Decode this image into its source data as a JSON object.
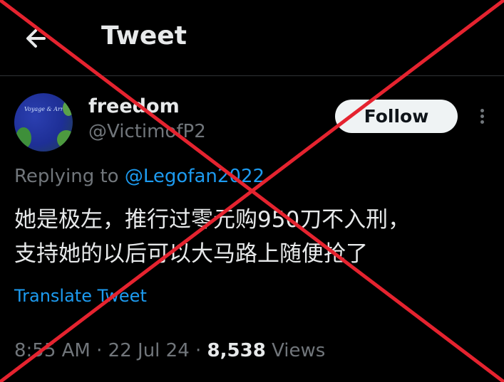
{
  "header": {
    "title": "Tweet",
    "back_icon": "arrow-left-icon"
  },
  "author": {
    "display_name": "freedom",
    "handle": "@VictimofP2",
    "avatar_text": "Voyage & Arrival"
  },
  "follow_label": "Follow",
  "more_icon": "more-vertical-icon",
  "reply": {
    "prefix": "Replying to",
    "mention": "@Legofan2022"
  },
  "tweet_text": {
    "line1": "她是极左，推行过零元购950刀不入刑，",
    "line2": "支持她的以后可以大马路上随便抢了"
  },
  "translate_label": "Translate Tweet",
  "meta": {
    "time": "8:55 AM",
    "sep1": "·",
    "date": "22 Jul 24",
    "sep2": "·",
    "views_count": "8,538",
    "views_label": "Views"
  },
  "overlay": {
    "icon": "red-x-cross-icon",
    "color": "#e5232f"
  }
}
